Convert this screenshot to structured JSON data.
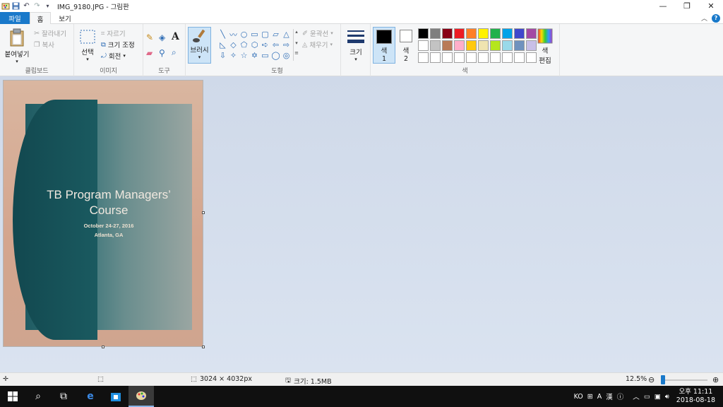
{
  "window": {
    "title": "IMG_9180.JPG - 그림판"
  },
  "tabs": {
    "file": "파일",
    "home": "홈",
    "view": "보기"
  },
  "ribbon": {
    "clipboard": {
      "label": "클립보드",
      "paste": "붙여넣기",
      "cut": "잘라내기",
      "copy": "복사"
    },
    "image": {
      "label": "이미지",
      "select": "선택",
      "crop": "자르기",
      "resize": "크기 조정",
      "rotate": "회전"
    },
    "tools": {
      "label": "도구"
    },
    "brushes": {
      "label": "브러시"
    },
    "shapes": {
      "label": "도형",
      "outline": "윤곽선",
      "fill": "채우기",
      "glyphs": [
        "╲",
        "〰",
        "○",
        "▭",
        "▢",
        "▱",
        "△",
        "◺",
        "◇",
        "⬠",
        "⬡",
        "➪",
        "⇦",
        "⇨",
        "⇩",
        "✧",
        "☆",
        "✡",
        "▭",
        "◯",
        "◎"
      ]
    },
    "size": {
      "label": "크기"
    },
    "colors": {
      "label": "색",
      "color1": "색\n1",
      "color1_line1": "색",
      "color1_line2": "1",
      "color2_line1": "색",
      "color2_line2": "2",
      "edit_line1": "색",
      "edit_line2": "편집",
      "color1_value": "#000000",
      "color2_value": "#ffffff",
      "palette": [
        "#000000",
        "#7f7f7f",
        "#880015",
        "#ed1c24",
        "#ff7f27",
        "#fff200",
        "#22b14c",
        "#00a2e8",
        "#3f48cc",
        "#a349a4",
        "#ffffff",
        "#c3c3c3",
        "#b97a57",
        "#ffaec9",
        "#ffc90e",
        "#efe4b0",
        "#b5e61d",
        "#99d9ea",
        "#7092be",
        "#c8bfe7",
        "#ffffff",
        "#ffffff",
        "#ffffff",
        "#ffffff",
        "#ffffff",
        "#ffffff",
        "#ffffff",
        "#ffffff",
        "#ffffff",
        "#ffffff"
      ]
    }
  },
  "canvas": {
    "cover_title_line1": "TB Program Managers’",
    "cover_title_line2": "Course",
    "cover_date": "October 24-27, 2016",
    "cover_city": "Atlanta, GA"
  },
  "status": {
    "dimensions": "3024 × 4032px",
    "size": "크기: 1.5MB",
    "zoom": "12.5%",
    "zoom_level": 0.0
  },
  "taskbar": {
    "ime": "KO",
    "ime_char": "漢",
    "time": "오후 11:11",
    "date": "2018-08-18"
  }
}
